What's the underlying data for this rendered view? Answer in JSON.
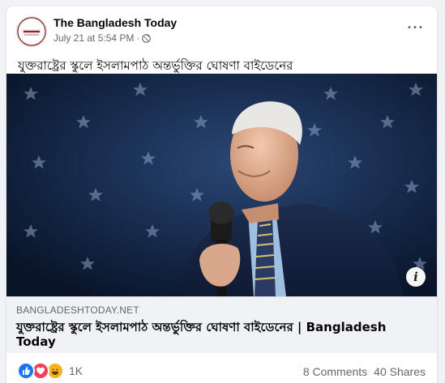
{
  "post": {
    "page_name": "The Bangladesh Today",
    "timestamp": "July 21 at 5:54 PM",
    "separator": "·",
    "text": "যুক্তরাষ্ট্রের স্কুলে ইসলামপাঠ অন্তর্ভুক্তির ঘোষণা বাইডেনের"
  },
  "link_preview": {
    "domain": "BANGLADESHTODAY.NET",
    "title": "যুক্তরাষ্ট্রের স্কুলে ইসলামপাঠ অন্তর্ভুক্তির ঘোষণা বাইডেনের | Bangladesh Today"
  },
  "engagement": {
    "reaction_count": "1K",
    "comments": "8 Comments",
    "shares": "40 Shares"
  },
  "icons": [
    "avatar-logo",
    "globe-icon",
    "more-options-icon",
    "info-icon",
    "like-icon",
    "love-icon",
    "haha-icon"
  ],
  "colors": {
    "like": "#1877f2",
    "love": "#f33e58",
    "haha": "#f7b125",
    "background": "#f0f2f5"
  }
}
